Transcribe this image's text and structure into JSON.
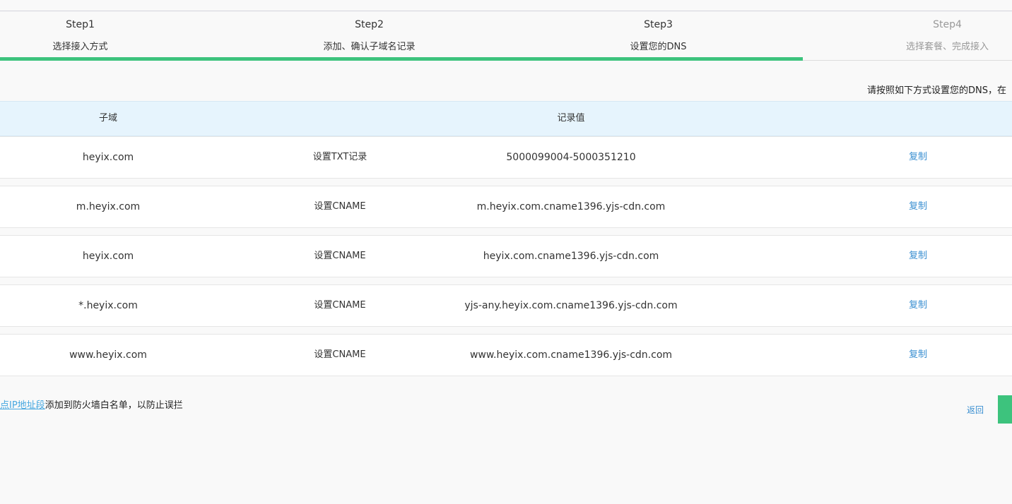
{
  "steps": [
    {
      "num": "Step1",
      "title": "选择接入方式"
    },
    {
      "num": "Step2",
      "title": "添加、确认子域名记录"
    },
    {
      "num": "Step3",
      "title": "设置您的DNS"
    },
    {
      "num": "Step4",
      "title": "选择套餐、完成接入"
    }
  ],
  "progress": {
    "completed_steps": 3,
    "total_steps": 4,
    "color": "#3dc37d"
  },
  "instruction": "请按照如下方式设置您的DNS，在",
  "table": {
    "headers": {
      "subdomain": "子域",
      "record_value": "记录值"
    },
    "rows": [
      {
        "subdomain": "heyix.com",
        "type": "设置TXT记录",
        "value": "5000099004-5000351210",
        "action": "复制"
      },
      {
        "subdomain": "m.heyix.com",
        "type": "设置CNAME",
        "value": "m.heyix.com.cname1396.yjs-cdn.com",
        "action": "复制"
      },
      {
        "subdomain": "heyix.com",
        "type": "设置CNAME",
        "value": "heyix.com.cname1396.yjs-cdn.com",
        "action": "复制"
      },
      {
        "subdomain": "*.heyix.com",
        "type": "设置CNAME",
        "value": "yjs-any.heyix.com.cname1396.yjs-cdn.com",
        "action": "复制"
      },
      {
        "subdomain": "www.heyix.com",
        "type": "设置CNAME",
        "value": "www.heyix.com.cname1396.yjs-cdn.com",
        "action": "复制"
      }
    ]
  },
  "footer": {
    "link_text": "点IP地址段",
    "note_text": "添加到防火墙白名单，以防止误拦"
  },
  "actions": {
    "back_label": "返回"
  },
  "colors": {
    "accent_green": "#3dc37d",
    "link_blue": "#3a8fd1",
    "header_bg": "#e6f4fd"
  }
}
